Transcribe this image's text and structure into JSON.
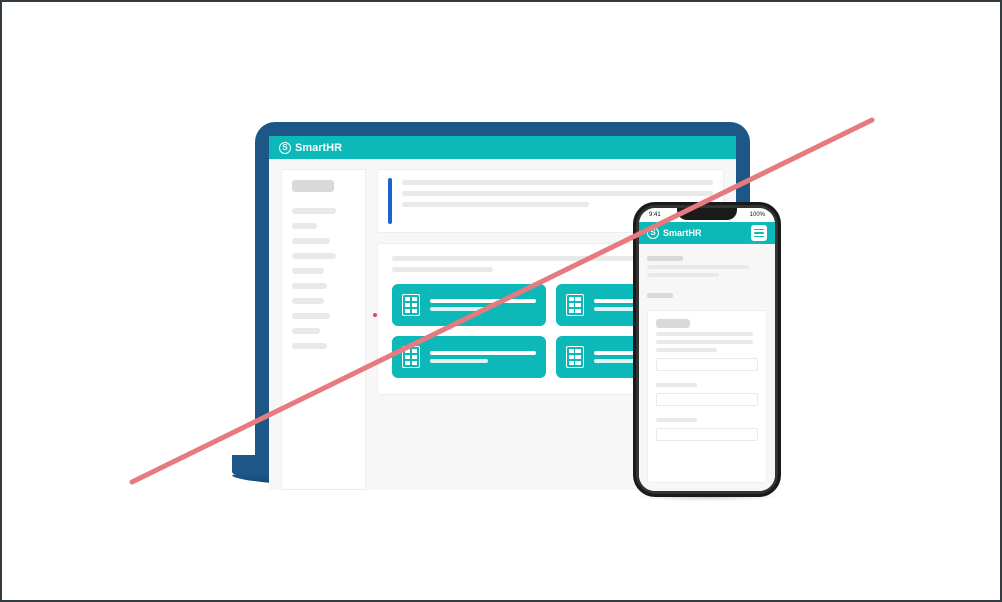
{
  "brand": {
    "name": "SmartHR",
    "icon_glyph": "S"
  },
  "phone": {
    "status": {
      "time": "9:41",
      "right": "100%"
    },
    "menu_label": "menu"
  },
  "colors": {
    "teal": "#0cb8b8",
    "navy": "#1c5788",
    "cross": "#e77a7f"
  }
}
